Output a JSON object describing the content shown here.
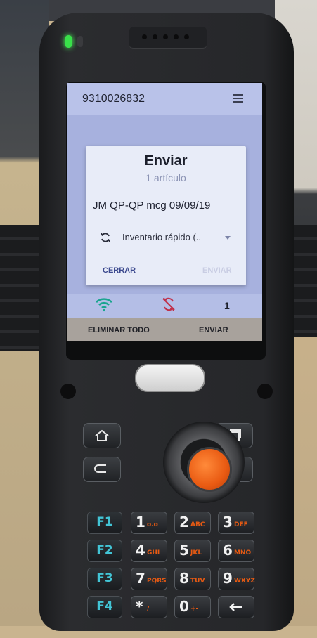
{
  "app": {
    "scan_code": "9310026832"
  },
  "dialog": {
    "title": "Enviar",
    "subtitle": "1 artículo",
    "name_value": "JM QP-QP mcg 09/09/19",
    "sync_selected": "Inventario rápido (..",
    "close_label": "CERRAR",
    "send_label": "ENVIAR"
  },
  "status": {
    "item_count": "1",
    "wifi_icon": "wifi-icon",
    "sync_off_icon": "sync-disabled-icon",
    "wifi_color": "#1aa58f",
    "sync_off_color": "#c0304a"
  },
  "bottom_bar": {
    "clear_all_label": "ELIMINAR TODO",
    "send_label": "ENVIAR"
  },
  "keypad": {
    "function_keys": [
      "F1",
      "F2",
      "F3",
      "F4"
    ],
    "number_keys": [
      {
        "num": "1",
        "sub": "o.o"
      },
      {
        "num": "2",
        "sub": "ABC"
      },
      {
        "num": "3",
        "sub": "DEF"
      },
      {
        "num": "4",
        "sub": "GHI"
      },
      {
        "num": "5",
        "sub": "JKL"
      },
      {
        "num": "6",
        "sub": "MNO"
      },
      {
        "num": "7",
        "sub": "PQRS"
      },
      {
        "num": "8",
        "sub": "TUV"
      },
      {
        "num": "9",
        "sub": "WXYZ"
      },
      {
        "num": "*",
        "sub": "/"
      },
      {
        "num": "0",
        "sub": "+-"
      }
    ]
  }
}
